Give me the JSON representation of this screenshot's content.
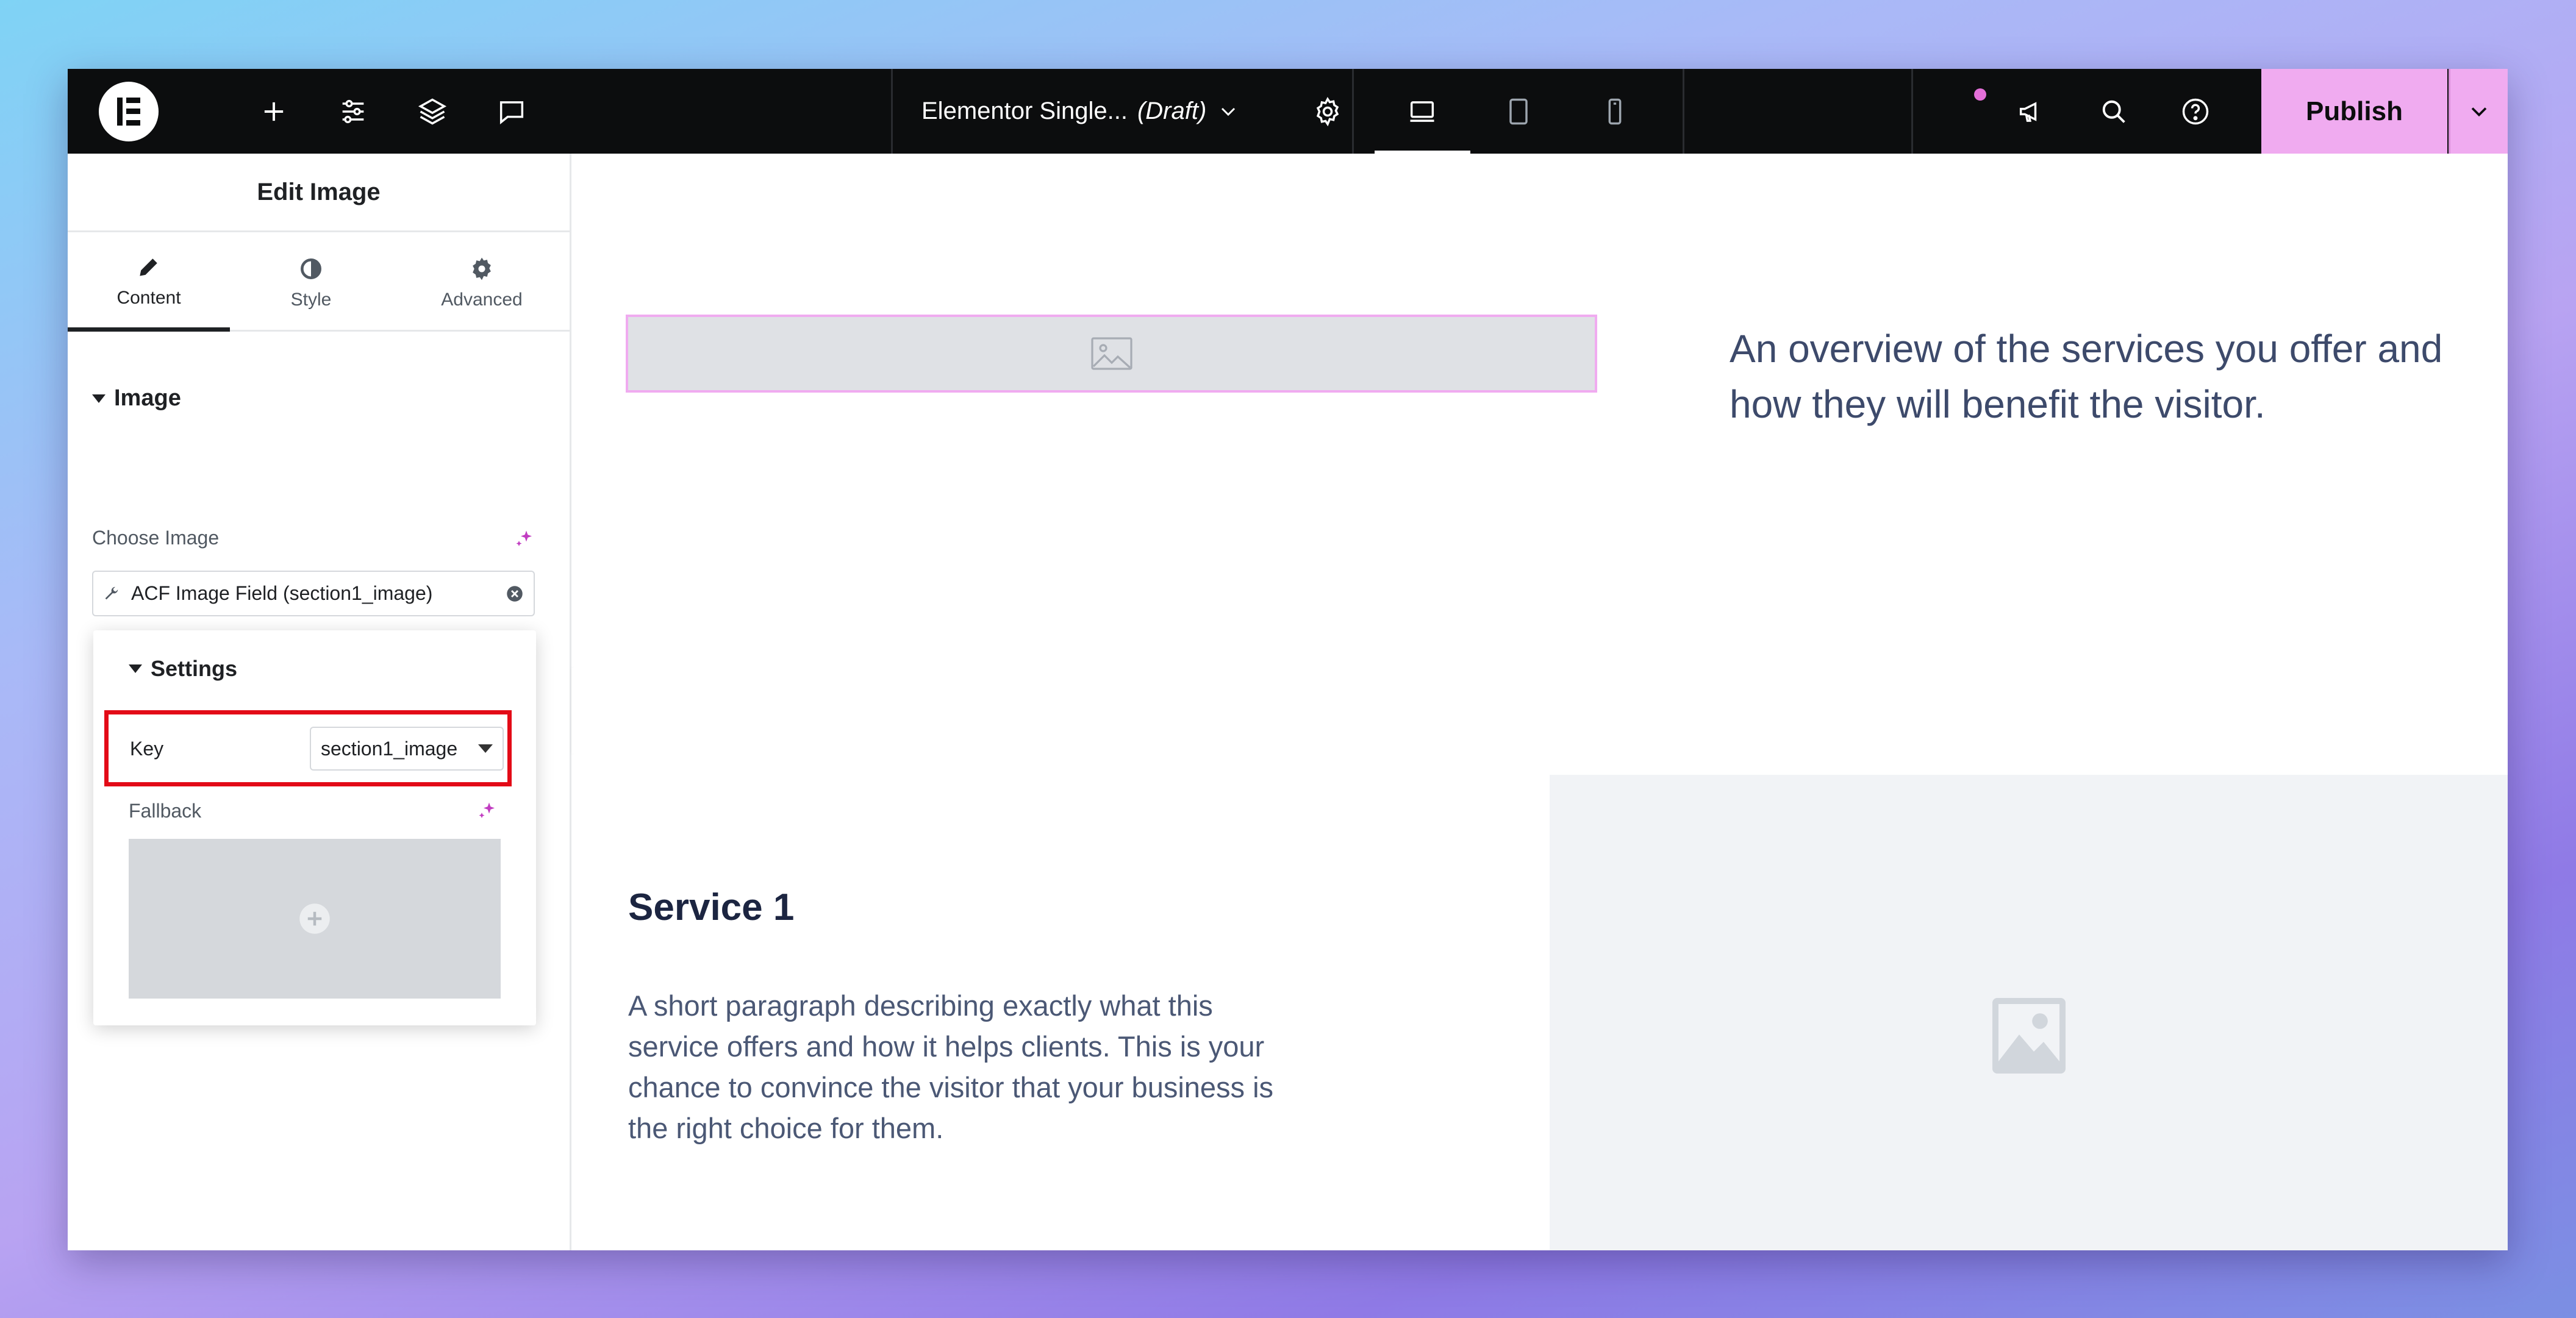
{
  "topbar": {
    "doc_title": "Elementor Single...",
    "doc_status": "(Draft)",
    "publish_label": "Publish"
  },
  "panel": {
    "title": "Edit Image",
    "tabs": [
      {
        "label": "Content",
        "icon": "pencil-icon",
        "active": true
      },
      {
        "label": "Style",
        "icon": "half-circle-icon",
        "active": false
      },
      {
        "label": "Advanced",
        "icon": "gear-icon",
        "active": false
      }
    ],
    "section_title": "Image",
    "choose_image_label": "Choose Image",
    "dynamic_field_value": "ACF Image Field (section1_image)",
    "settings": {
      "title": "Settings",
      "key_label": "Key",
      "key_value": "section1_image",
      "fallback_label": "Fallback"
    }
  },
  "canvas": {
    "overview_text": "An overview of the services you offer and how they will benefit the visitor.",
    "service_title": "Service 1",
    "service_text": "A short paragraph describing exactly what this service offers and how it helps clients. This is your chance to convince the visitor that your business is the right choice for them."
  },
  "colors": {
    "accent": "#f0abf0",
    "highlight": "#e30b17",
    "topbar_bg": "#0c0d0e"
  }
}
